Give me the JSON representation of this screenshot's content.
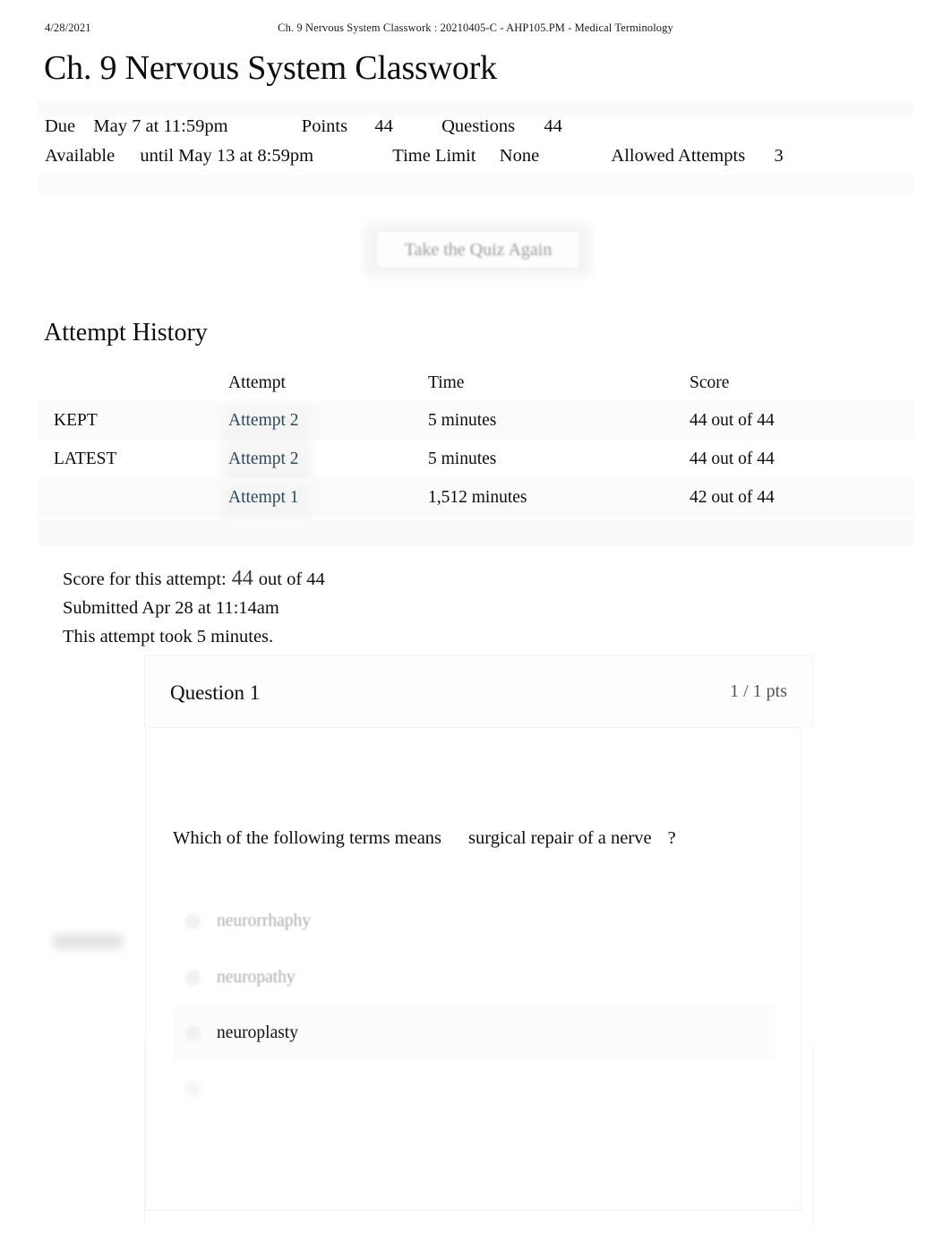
{
  "print_header": {
    "date": "4/28/2021",
    "title": "Ch. 9 Nervous System Classwork : 20210405-C - AHP105.PM - Medical Terminology"
  },
  "page_title": "Ch. 9 Nervous System Classwork",
  "meta": {
    "due_label": "Due",
    "due_value": "May 7 at 11:59pm",
    "points_label": "Points",
    "points_value": "44",
    "questions_label": "Questions",
    "questions_value": "44",
    "available_label": "Available",
    "available_value": "until May 13 at 8:59pm",
    "time_limit_label": "Time Limit",
    "time_limit_value": "None",
    "allowed_attempts_label": "Allowed Attempts",
    "allowed_attempts_value": "3"
  },
  "actions": {
    "take_quiz_again": "Take the Quiz Again"
  },
  "attempt_history": {
    "section_title": "Attempt History",
    "columns": [
      "",
      "Attempt",
      "Time",
      "Score"
    ],
    "rows": [
      {
        "kept": "KEPT",
        "attempt": "Attempt 2",
        "time": "5 minutes",
        "score": "44 out of 44"
      },
      {
        "kept": "LATEST",
        "attempt": "Attempt 2",
        "time": "5 minutes",
        "score": "44 out of 44"
      },
      {
        "kept": "",
        "attempt": "Attempt 1",
        "time": "1,512 minutes",
        "score": "42 out of 44"
      }
    ]
  },
  "score_summary": {
    "score_label": "Score for this attempt:",
    "score_value": "44",
    "score_out_of": "out of 44",
    "submitted": "Submitted Apr 28 at 11:14am",
    "duration": "This attempt took 5 minutes."
  },
  "question": {
    "title": "Question 1",
    "points": "1 / 1 pts",
    "text_part1": "Which of the following terms means",
    "text_part2": "surgical repair of a nerve",
    "text_part3": "?",
    "answers": [
      {
        "label": "neurorrhaphy",
        "state": "dim"
      },
      {
        "label": "neuropathy",
        "state": "dim"
      },
      {
        "label": "neuroplasty",
        "state": "picked"
      },
      {
        "label": "",
        "state": "obscured"
      }
    ]
  },
  "colors": {
    "link": "#2d4a5a",
    "text": "#0d0d0d",
    "muted": "#8d8d8d",
    "band": "#fafafa"
  }
}
